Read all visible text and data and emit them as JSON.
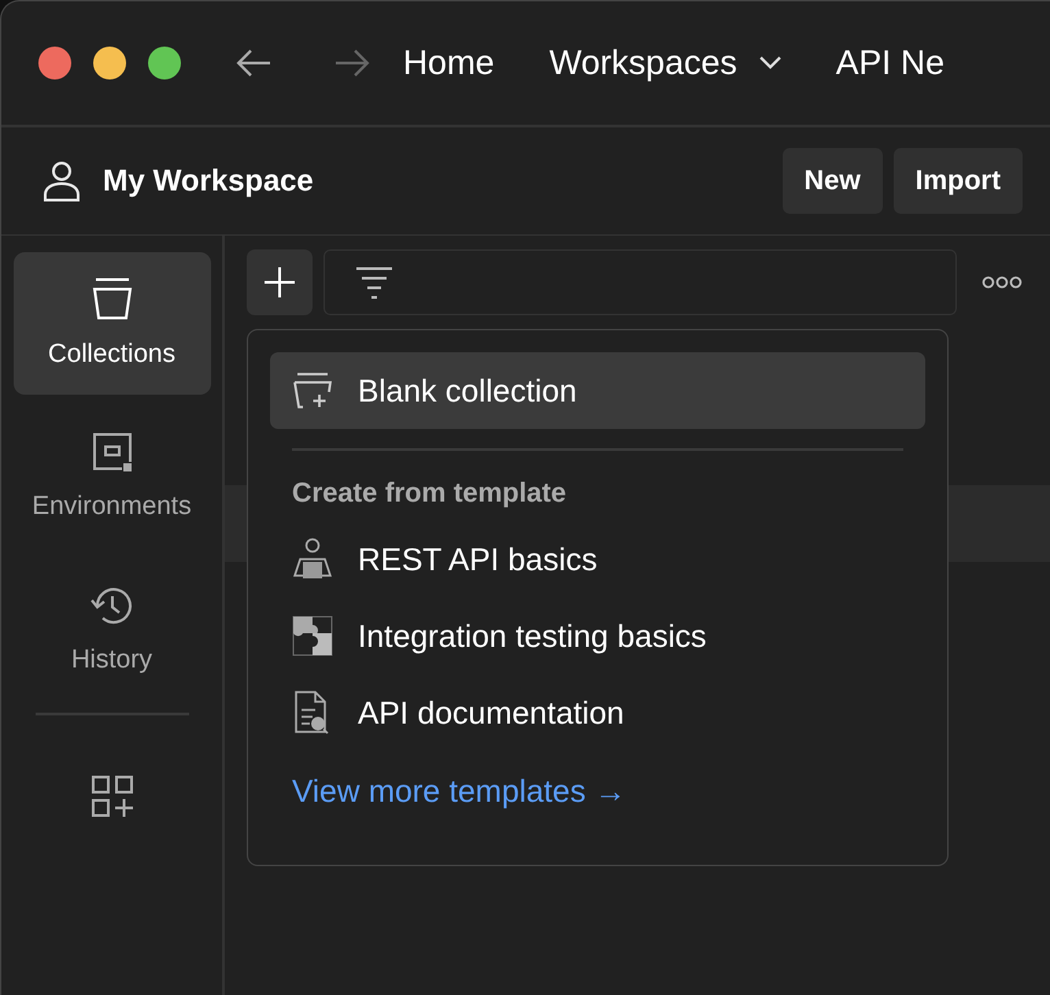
{
  "nav": {
    "history_buttons": [
      {
        "kind": "back",
        "disabled": false
      },
      {
        "kind": "forward",
        "disabled": true
      }
    ],
    "items": [
      {
        "label": "Home",
        "dropdown": false
      },
      {
        "label": "Workspaces",
        "dropdown": true
      },
      {
        "label": "API Ne",
        "dropdown": false
      }
    ]
  },
  "workspace": {
    "title": "My Workspace",
    "buttons": [
      "New",
      "Import"
    ]
  },
  "sidebar": {
    "items": [
      {
        "label": "Collections",
        "kind": "collections",
        "selected": true
      },
      {
        "label": "Environments",
        "kind": "environments",
        "selected": false
      },
      {
        "label": "History",
        "kind": "history",
        "selected": false
      }
    ]
  },
  "menu": {
    "items": [
      {
        "label": "Blank collection",
        "kind": "blank",
        "selected": true
      }
    ],
    "section_title": "Create from template",
    "templates": [
      {
        "label": "REST API basics",
        "kind": "rest"
      },
      {
        "label": "Integration testing basics",
        "kind": "integration"
      },
      {
        "label": "API documentation",
        "kind": "documentation"
      }
    ],
    "link": "View more templates →"
  }
}
